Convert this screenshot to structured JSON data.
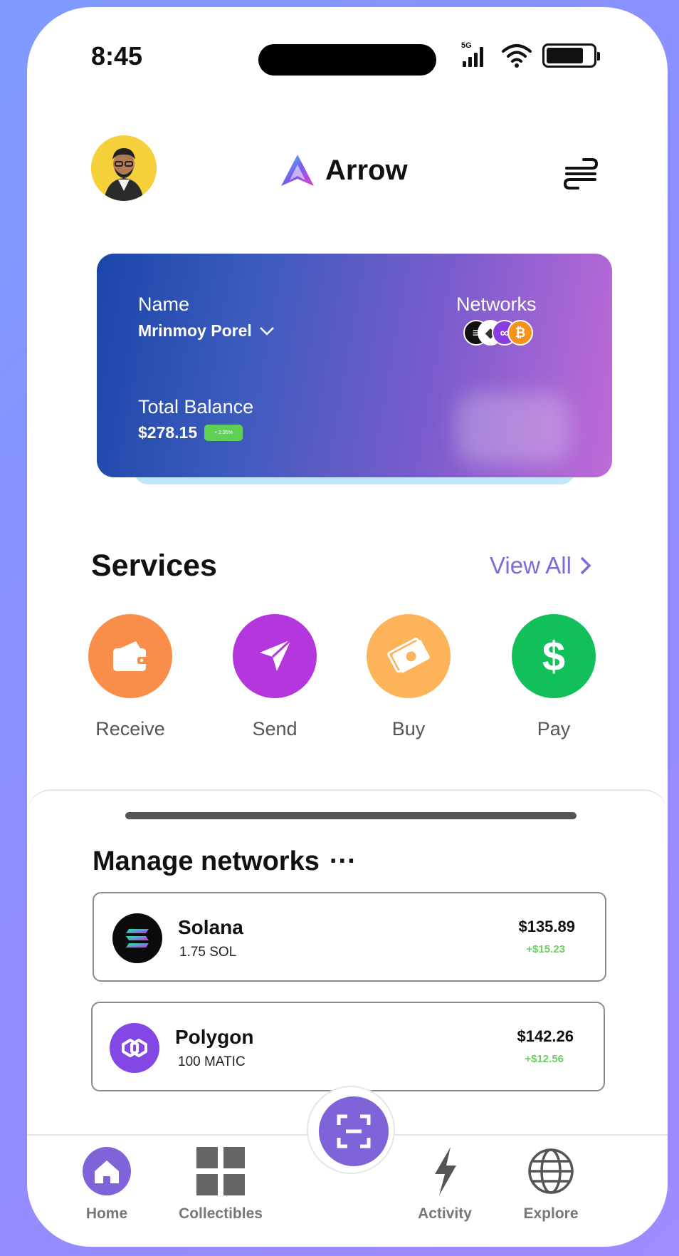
{
  "status_bar": {
    "time": "8:45",
    "network": "5G"
  },
  "header": {
    "app_title": "Arrow",
    "avatar": "user-avatar",
    "menu_icon": "swap-menu-icon"
  },
  "wallet_card": {
    "name_label": "Name",
    "name_value": "Mrinmoy Porel",
    "networks_label": "Networks",
    "balance_label": "Total Balance",
    "balance_value": "$278.15",
    "change_badge": "+ 2.95%",
    "network_icons": [
      "solana-icon",
      "ethereum-icon",
      "polygon-icon",
      "bitcoin-icon"
    ]
  },
  "services": {
    "title": "Services",
    "view_all": "View All",
    "items": [
      {
        "label": "Receive",
        "color": "#f98e4a",
        "icon": "wallet-icon"
      },
      {
        "label": "Send",
        "color": "#b437dd",
        "icon": "send-arrow-icon"
      },
      {
        "label": "Buy",
        "color": "#fdb35a",
        "icon": "cash-icon"
      },
      {
        "label": "Pay",
        "color": "#12c05b",
        "icon": "dollar-icon"
      }
    ]
  },
  "manage_networks": {
    "title": "Manage networks",
    "more": "···",
    "items": [
      {
        "name": "Solana",
        "amount": "1.75 SOL",
        "usd": "$135.89",
        "change": "+$15.23"
      },
      {
        "name": "Polygon",
        "amount": "100 MATIC",
        "usd": "$142.26",
        "change": "+$12.56"
      }
    ]
  },
  "tabbar": {
    "items": [
      {
        "label": "Home"
      },
      {
        "label": "Collectibles"
      },
      {
        "label": "Activity"
      },
      {
        "label": "Explore"
      }
    ]
  },
  "colors": {
    "accent": "#7e64d8",
    "positive": "#6ccf63"
  }
}
